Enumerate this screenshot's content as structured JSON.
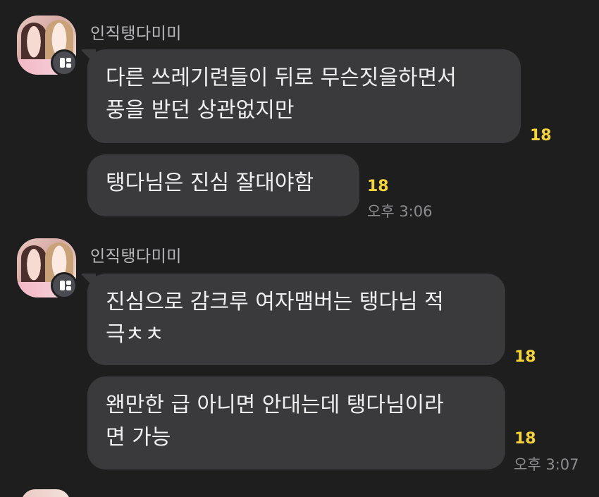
{
  "groups": [
    {
      "sender": "인직탱다미미",
      "messages": [
        {
          "text": "다른 쓰레기련들이 뒤로 무슨짓을하면서\n풍을 받던 상관없지만",
          "unread": "18",
          "time": ""
        },
        {
          "text": "탱다님은 진심 잘대야함",
          "unread": "18",
          "time": "오후 3:06"
        }
      ]
    },
    {
      "sender": "인직탱다미미",
      "messages": [
        {
          "text": "진심으로 감크루 여자맴버는 탱다님 적\n극ㅊㅊ",
          "unread": "18",
          "time": ""
        },
        {
          "text": "왠만한 급 아니면 안대는데 탱다님이라\n면 가능",
          "unread": "18",
          "time": "오후 3:07"
        }
      ]
    }
  ],
  "colors": {
    "background": "#1e1e1f",
    "bubble": "#3a3a3d",
    "text": "#f0f0f0",
    "unread": "#f5d33b",
    "meta": "#8d8d90"
  }
}
